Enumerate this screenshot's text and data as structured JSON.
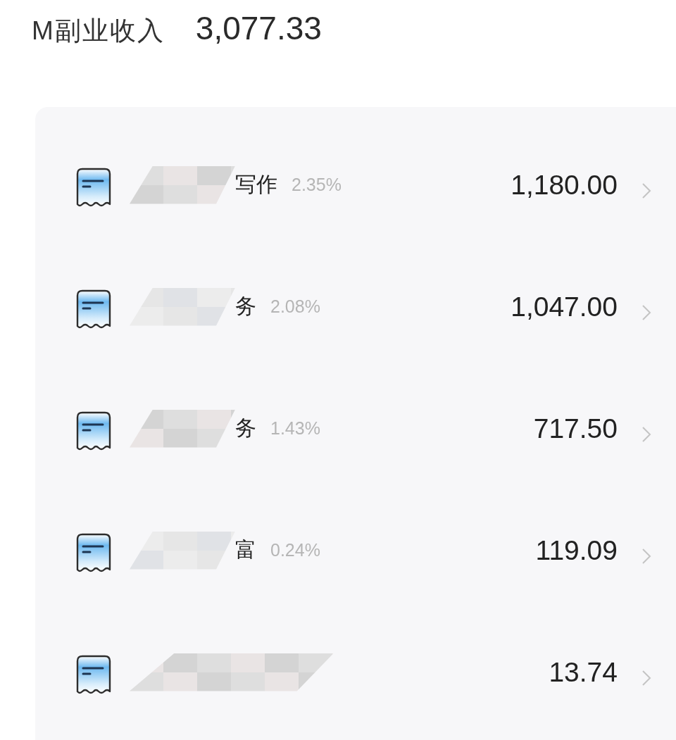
{
  "header": {
    "title": "M副业收入",
    "total": "3,077.33"
  },
  "items": [
    {
      "name": "写作",
      "percent": "2.35%",
      "amount": "1,180.00"
    },
    {
      "name": "务",
      "percent": "2.08%",
      "amount": "1,047.00"
    },
    {
      "name": "务",
      "percent": "1.43%",
      "amount": "717.50"
    },
    {
      "name": "富",
      "percent": "0.24%",
      "amount": "119.09"
    },
    {
      "amount": "13.74"
    }
  ]
}
